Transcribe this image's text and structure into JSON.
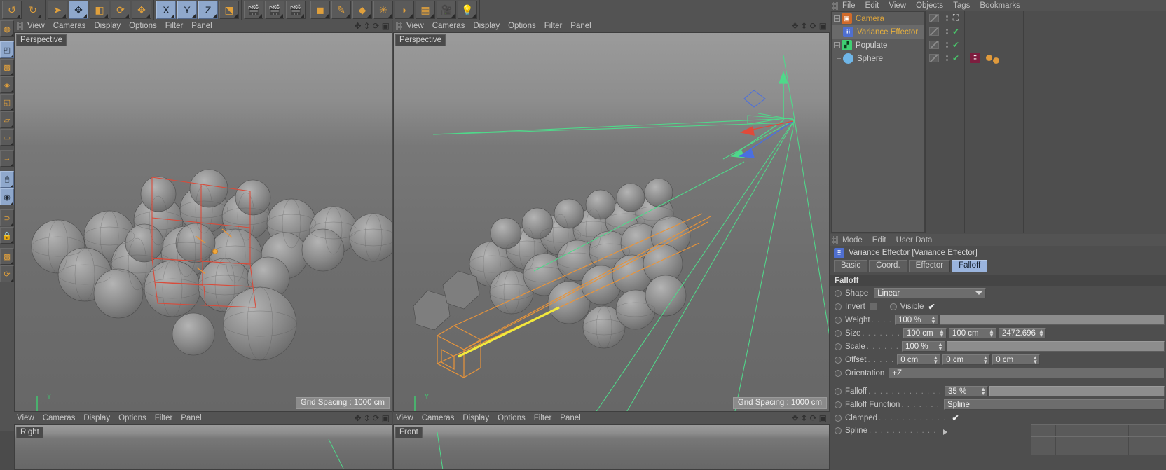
{
  "toolbar": {
    "groups": [
      {
        "name": "history",
        "buttons": [
          {
            "name": "undo-icon",
            "glyph": "↺",
            "state": "off"
          },
          {
            "name": "redo-icon",
            "glyph": "↻",
            "state": "disabled"
          }
        ]
      },
      {
        "name": "modes",
        "buttons": [
          {
            "name": "select-tool-icon",
            "glyph": "➤",
            "state": "off"
          },
          {
            "name": "move-tool-icon",
            "glyph": "✥",
            "state": "on"
          },
          {
            "name": "scale-tool-icon",
            "glyph": "◧",
            "state": "off"
          },
          {
            "name": "rotate-tool-icon",
            "glyph": "⟳",
            "state": "off"
          },
          {
            "name": "move-alt-tool-icon",
            "glyph": "✥",
            "state": "off"
          }
        ]
      },
      {
        "name": "axis-locks",
        "buttons": [
          {
            "name": "x-axis-lock-icon",
            "glyph": "X",
            "state": "on"
          },
          {
            "name": "y-axis-lock-icon",
            "glyph": "Y",
            "state": "on"
          },
          {
            "name": "z-axis-lock-icon",
            "glyph": "Z",
            "state": "on"
          },
          {
            "name": "world-object-coordinate-icon",
            "glyph": "⬔",
            "state": "off"
          }
        ]
      },
      {
        "name": "render",
        "buttons": [
          {
            "name": "render-view-icon",
            "glyph": "🎬",
            "state": "off"
          },
          {
            "name": "render-region-icon",
            "glyph": "🎬",
            "state": "off"
          },
          {
            "name": "render-settings-icon",
            "glyph": "🎬",
            "state": "off"
          }
        ]
      },
      {
        "name": "primitives",
        "buttons": [
          {
            "name": "cube-primitive-icon",
            "glyph": "◼",
            "state": "off"
          },
          {
            "name": "spline-pen-icon",
            "glyph": "✎",
            "state": "off"
          },
          {
            "name": "generators-icon",
            "glyph": "◆",
            "state": "off"
          },
          {
            "name": "deformers-icon",
            "glyph": "✳",
            "state": "off"
          },
          {
            "name": "scene-object-icon",
            "glyph": "◗",
            "state": "off"
          },
          {
            "name": "floor-environment-icon",
            "glyph": "▦",
            "state": "off"
          },
          {
            "name": "camera-icon",
            "glyph": "🎥",
            "state": "off"
          },
          {
            "name": "light-icon",
            "glyph": "💡",
            "state": "off"
          }
        ]
      }
    ]
  },
  "left_tools": [
    {
      "name": "live-selection-icon",
      "glyph": "◍",
      "state": "off"
    },
    {
      "name": "point-mode-icon",
      "glyph": "◰",
      "state": "on"
    },
    {
      "name": "edge-mode-icon",
      "glyph": "▩",
      "state": "off"
    },
    {
      "name": "polygon-mode-icon",
      "glyph": "◈",
      "state": "off"
    },
    {
      "name": "model-mode-icon",
      "glyph": "◱",
      "state": "off"
    },
    {
      "name": "object-mode-icon",
      "glyph": "▱",
      "state": "off"
    },
    {
      "name": "texture-mode-icon",
      "glyph": "▭",
      "state": "off"
    },
    {
      "name": "axis-mode-icon",
      "glyph": "→",
      "state": "off"
    },
    {
      "name": "enable-axis-icon",
      "glyph": "🖱",
      "state": "on"
    },
    {
      "name": "viewport-solo-icon",
      "glyph": "◉",
      "state": "on"
    },
    {
      "name": "snap-icon",
      "glyph": "⊃",
      "state": "off"
    },
    {
      "name": "lock-workplane-icon",
      "glyph": "🔒",
      "state": "off"
    },
    {
      "name": "workplane-icon",
      "glyph": "▩",
      "state": "off"
    },
    {
      "name": "planar-workplane-icon",
      "glyph": "⟳",
      "state": "off"
    }
  ],
  "viewport_menu": [
    "View",
    "Cameras",
    "Display",
    "Options",
    "Filter",
    "Panel"
  ],
  "viewport_nav_icons": [
    "pan-icon",
    "zoom-icon",
    "rotate-icon",
    "maximize-icon"
  ],
  "viewports": [
    {
      "name": "viewport-top-left",
      "label": "Perspective",
      "grid_spacing": "Grid Spacing : 1000 cm"
    },
    {
      "name": "viewport-top-right",
      "label": "Perspective",
      "grid_spacing": "Grid Spacing : 1000 cm"
    },
    {
      "name": "viewport-bottom-left",
      "label": "Right",
      "grid_spacing": ""
    },
    {
      "name": "viewport-bottom-right",
      "label": "Front",
      "grid_spacing": ""
    }
  ],
  "object_manager": {
    "menu": [
      "File",
      "Edit",
      "View",
      "Objects",
      "Tags",
      "Bookmarks"
    ],
    "rows": [
      {
        "name": "Camera",
        "depth": 0,
        "icon": "camera-object-icon",
        "icon_color": "#d06a2a",
        "text_color": "#d9a23c",
        "expander": "-",
        "selected": false,
        "visibility_dots": true,
        "tag_check": false,
        "tag_extra": "axis"
      },
      {
        "name": "Variance Effector",
        "depth": 1,
        "icon": "mograph-effector-icon",
        "icon_color": "#4f6fd0",
        "text_color": "#e8b13e",
        "expander": "",
        "selected": true,
        "visibility_dots": true,
        "tag_check": true,
        "tag_extra": ""
      },
      {
        "name": "Populate",
        "depth": 0,
        "icon": "cloner-object-icon",
        "icon_color": "#3fcf72",
        "text_color": "#cfcfcf",
        "expander": "-",
        "selected": false,
        "visibility_dots": true,
        "tag_check": true,
        "tag_extra": ""
      },
      {
        "name": "Sphere",
        "depth": 1,
        "icon": "sphere-object-icon",
        "icon_color": "#6fb6e8",
        "text_color": "#cfcfcf",
        "expander": "",
        "selected": false,
        "visibility_dots": true,
        "tag_check": true,
        "tag_extra": "effector-tag"
      }
    ]
  },
  "attributes": {
    "menu": [
      "Mode",
      "Edit",
      "User Data"
    ],
    "header": "Variance Effector [Variance Effector]",
    "header_icon": "mograph-effector-icon",
    "tabs": [
      {
        "label": "Basic",
        "selected": false
      },
      {
        "label": "Coord.",
        "selected": false
      },
      {
        "label": "Effector",
        "selected": false
      },
      {
        "label": "Falloff",
        "selected": true
      }
    ],
    "group_title": "Falloff",
    "fields": {
      "shape_label": "Shape",
      "shape_value": "Linear",
      "invert_label": "Invert",
      "invert_checked": false,
      "visible_label": "Visible",
      "visible_checked": true,
      "weight_label": "Weight",
      "weight_value": "100 %",
      "size_label": "Size",
      "size_x": "100 cm",
      "size_y": "100 cm",
      "size_z": "2472.696",
      "scale_label": "Scale",
      "scale_value": "100 %",
      "offset_label": "Offset",
      "offset_x": "0 cm",
      "offset_y": "0 cm",
      "offset_z": "0 cm",
      "orientation_label": "Orientation",
      "orientation_value": "+Z",
      "falloff_label": "Falloff",
      "falloff_value": "35 %",
      "falloff_function_label": "Falloff Function",
      "falloff_function_value": "Spline",
      "clamped_label": "Clamped",
      "clamped_checked": true,
      "spline_label": "Spline"
    }
  },
  "colors": {
    "accent_blue": "#9ab4dd",
    "selection_red": "#d94b3a",
    "green_wire": "#4fd98a",
    "orange_wire": "#e8943a",
    "yellow_wire": "#f2e93c",
    "check_green": "#49c46a"
  }
}
